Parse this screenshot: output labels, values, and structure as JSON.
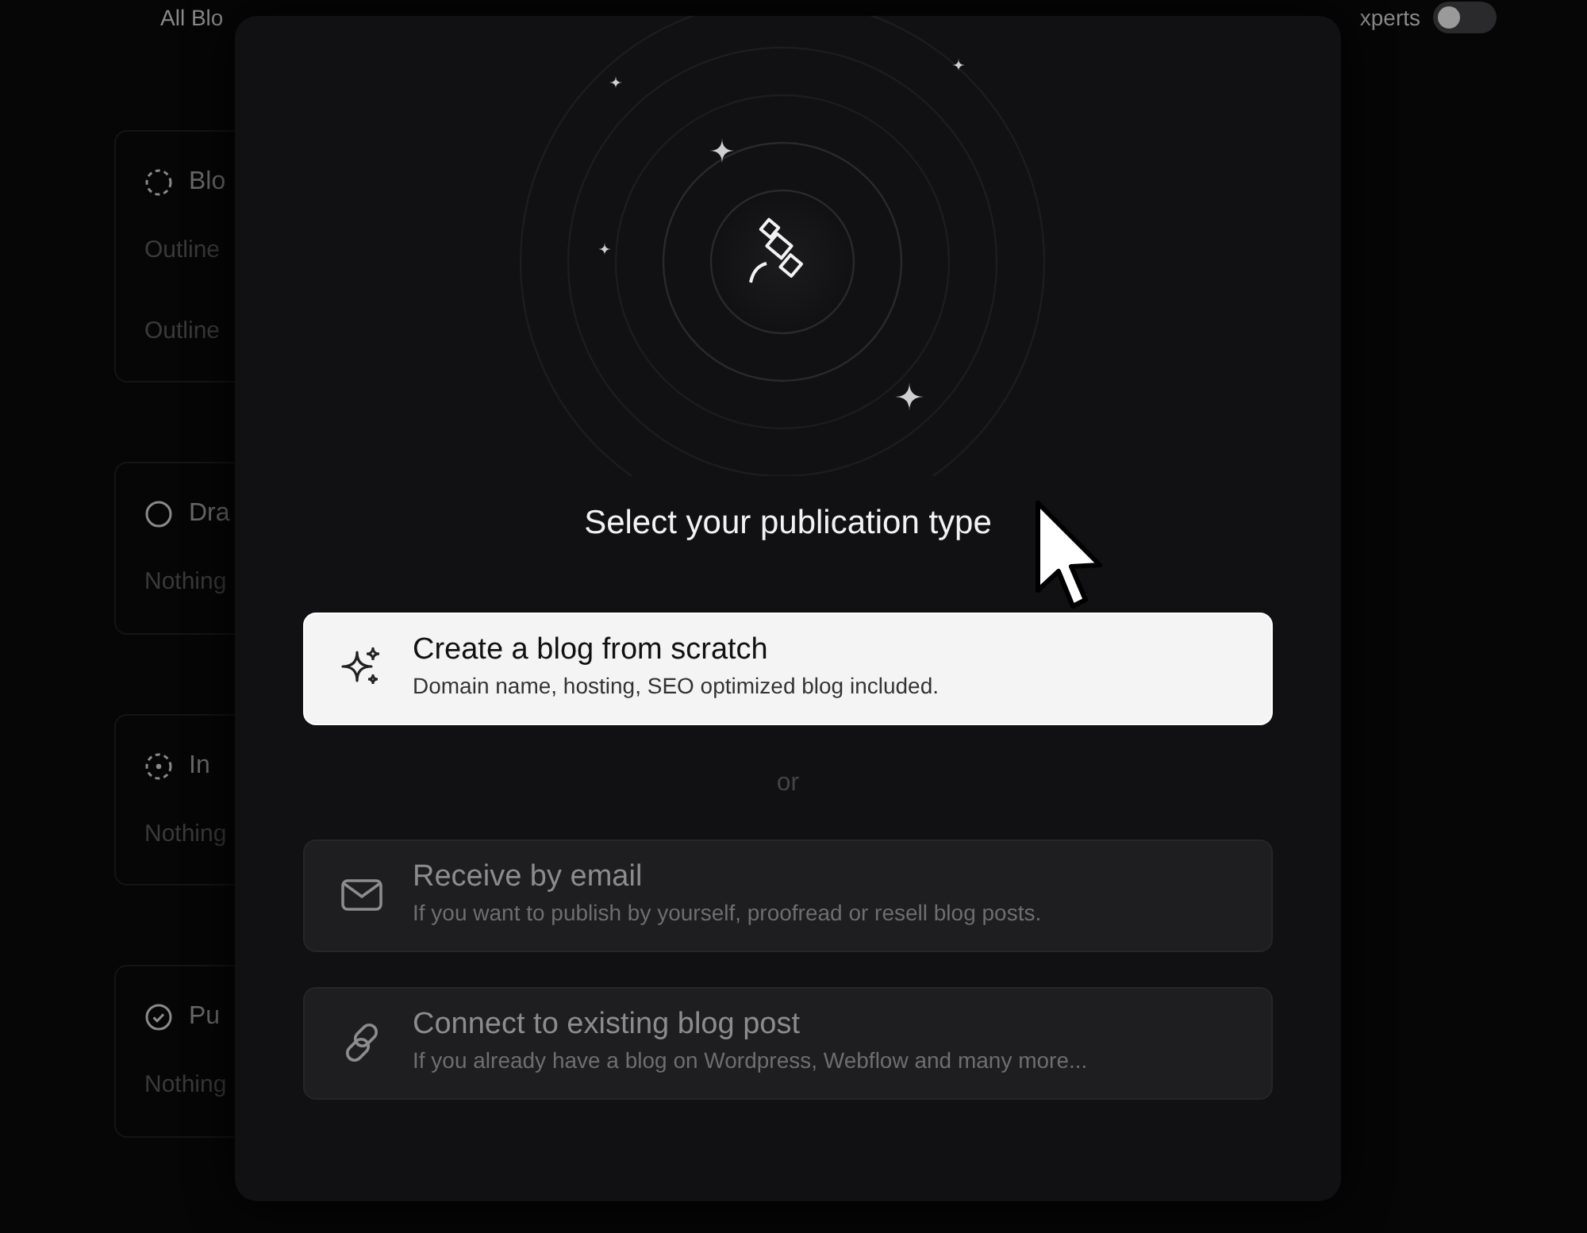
{
  "top_bar": {
    "left_text": "All Blo",
    "right_text": "xperts",
    "toggle": {
      "on": false
    }
  },
  "columns": [
    {
      "title": "Blo",
      "kind": "outline",
      "notes": [
        "Outline",
        "Outline"
      ]
    },
    {
      "title": "Dra",
      "kind": "draft",
      "notes": [
        "Nothing"
      ]
    },
    {
      "title": "In",
      "kind": "progress",
      "notes": [
        "Nothing"
      ]
    },
    {
      "title": "Pu",
      "kind": "published",
      "notes": [
        "Nothing"
      ]
    }
  ],
  "dialog": {
    "title": "Select your publication type",
    "separator": "or",
    "options": [
      {
        "kind": "sparkles",
        "title": "Create a blog from scratch",
        "description": "Domain name, hosting, SEO optimized blog included.",
        "selected": true
      },
      {
        "kind": "email",
        "title": "Receive by email",
        "description": "If you want to publish by yourself, proofread or resell blog posts.",
        "selected": false
      },
      {
        "kind": "link",
        "title": "Connect to existing blog post",
        "description": "If you already have a blog on Wordpress, Webflow and many more...",
        "selected": false
      }
    ]
  }
}
